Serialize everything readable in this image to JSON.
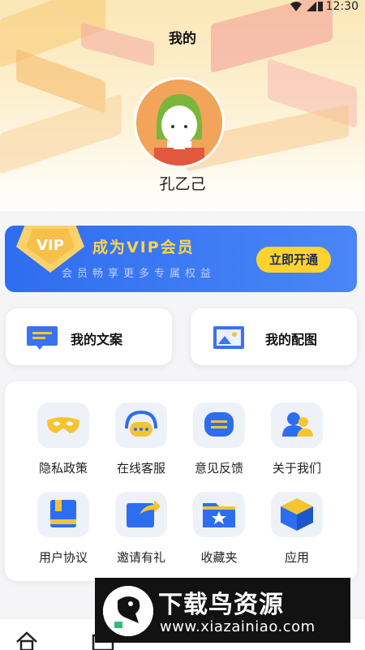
{
  "status_bar": {
    "time": "12:30"
  },
  "header": {
    "title": "我的"
  },
  "profile": {
    "username": "孔乙己"
  },
  "vip_card": {
    "badge_text": "VIP",
    "title": "成为VIP会员",
    "subtitle": "会员畅享更多专属权益",
    "button_label": "立即开通"
  },
  "quick_actions": [
    {
      "label": "我的文案",
      "icon": "message-icon"
    },
    {
      "label": "我的配图",
      "icon": "image-icon"
    }
  ],
  "menu_grid": [
    {
      "label": "隐私政策",
      "icon": "mask-icon"
    },
    {
      "label": "在线客服",
      "icon": "headset-icon"
    },
    {
      "label": "意见反馈",
      "icon": "feedback-icon"
    },
    {
      "label": "关于我们",
      "icon": "users-icon"
    },
    {
      "label": "用户协议",
      "icon": "book-icon"
    },
    {
      "label": "邀请有礼",
      "icon": "share-icon"
    },
    {
      "label": "收藏夹",
      "icon": "star-folder-icon"
    },
    {
      "label": "应用",
      "icon": "box-icon"
    }
  ],
  "watermark": {
    "title": "下载鸟资源",
    "url": "www.xiazainiao.com"
  },
  "colors": {
    "accent_blue": "#2f6df0",
    "vip_gold": "#ffd44d",
    "icon_yellow": "#f6c432",
    "icon_blue": "#2c6ef2"
  }
}
